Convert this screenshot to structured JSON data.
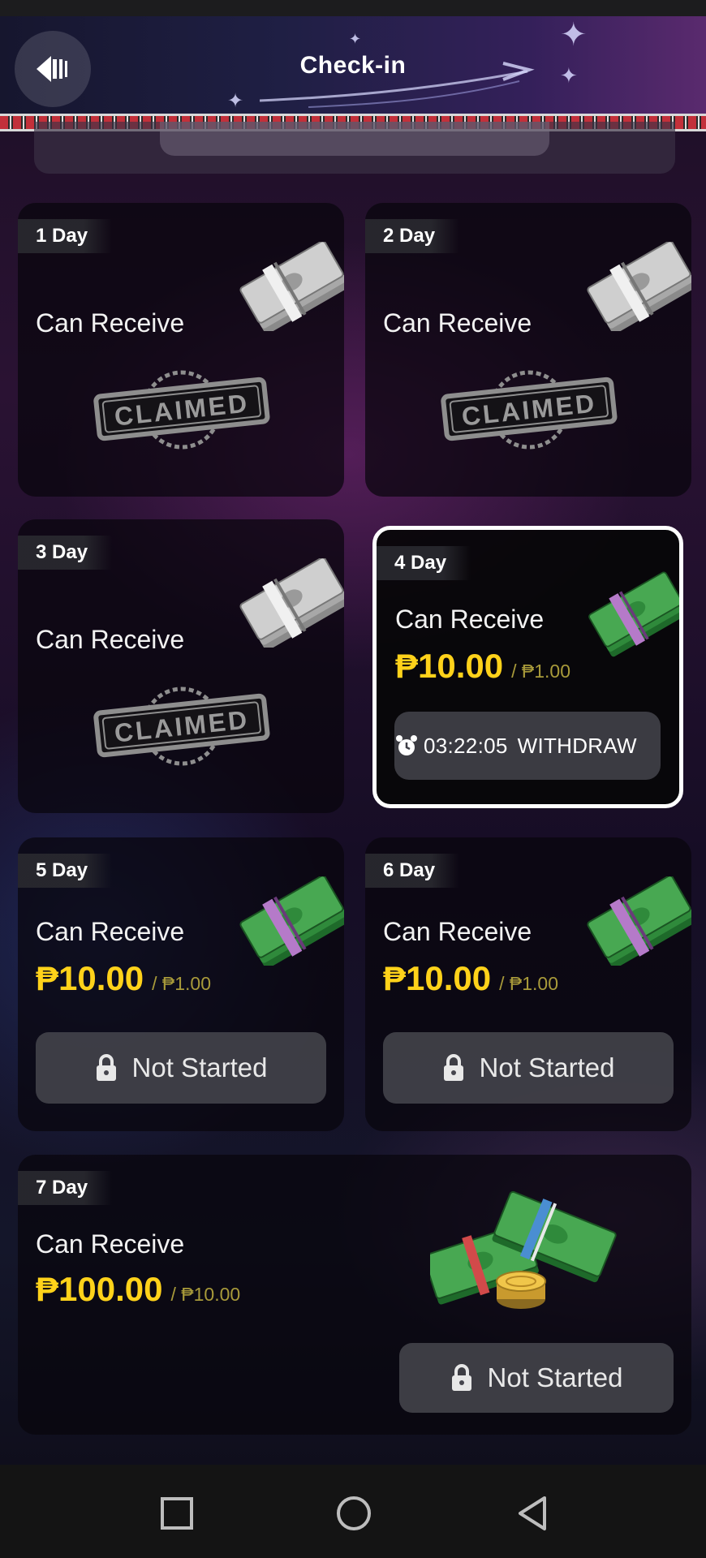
{
  "header": {
    "title": "Check-in",
    "back_icon": "back-arrow-icon"
  },
  "colors": {
    "amount": "#ffd21a",
    "active_border": "#ffffff"
  },
  "days": [
    {
      "day": "1 Day",
      "status": "Can Receive",
      "state": "claimed",
      "stamp": "CLAIMED"
    },
    {
      "day": "2 Day",
      "status": "Can Receive",
      "state": "claimed",
      "stamp": "CLAIMED"
    },
    {
      "day": "3 Day",
      "status": "Can Receive",
      "state": "claimed",
      "stamp": "CLAIMED"
    },
    {
      "day": "4 Day",
      "status": "Can Receive",
      "state": "active",
      "amount": "₱10.00",
      "base": "/ ₱1.00",
      "timer": "03:22:05",
      "action": "WITHDRAW"
    },
    {
      "day": "5 Day",
      "status": "Can Receive",
      "state": "locked",
      "amount": "₱10.00",
      "base": "/ ₱1.00",
      "action": "Not Started"
    },
    {
      "day": "6 Day",
      "status": "Can Receive",
      "state": "locked",
      "amount": "₱10.00",
      "base": "/ ₱1.00",
      "action": "Not Started"
    },
    {
      "day": "7 Day",
      "status": "Can Receive",
      "state": "locked",
      "amount": "₱100.00",
      "base": "/ ₱10.00",
      "action": "Not Started"
    }
  ],
  "nav": {
    "recents_icon": "square-icon",
    "home_icon": "circle-icon",
    "back_icon": "triangle-back-icon"
  }
}
